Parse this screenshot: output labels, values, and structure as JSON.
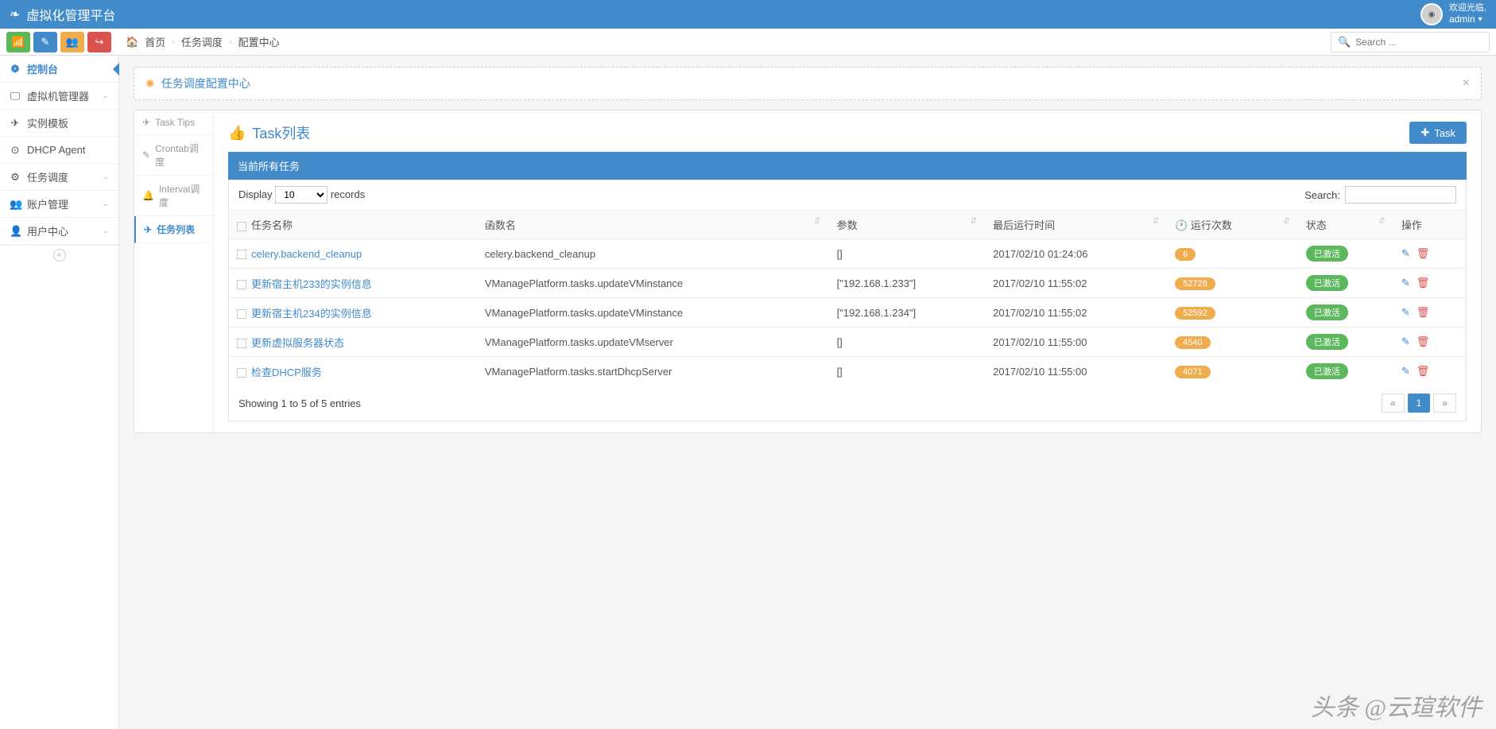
{
  "header": {
    "brand": "虚拟化管理平台",
    "greeting": "欢迎光临,",
    "username": "admin"
  },
  "breadcrumb": {
    "home": "首页",
    "items": [
      "任务调度",
      "配置中心"
    ]
  },
  "search": {
    "placeholder": "Search ..."
  },
  "sidebar": {
    "items": [
      {
        "label": "控制台",
        "active": true,
        "icon": "⚙"
      },
      {
        "label": "虚拟机管理器",
        "expandable": true,
        "icon": "🖵"
      },
      {
        "label": "实例模板",
        "icon": "✈"
      },
      {
        "label": "DHCP Agent",
        "icon": "⊙"
      },
      {
        "label": "任务调度",
        "expandable": true,
        "icon": "⚙"
      },
      {
        "label": "账户管理",
        "expandable": true,
        "icon": "👥"
      },
      {
        "label": "用户中心",
        "expandable": true,
        "icon": "👤"
      }
    ]
  },
  "alert": {
    "title": "任务调度配置中心"
  },
  "vtabs": [
    {
      "label": "Task Tips",
      "icon": "✈"
    },
    {
      "label": "Crontab调度",
      "icon": "✎"
    },
    {
      "label": "Interval调度",
      "icon": "🔔"
    },
    {
      "label": "任务列表",
      "icon": "✈",
      "active": true
    }
  ],
  "pane": {
    "title": "Task列表",
    "add_button": "Task",
    "bar": "当前所有任务"
  },
  "table": {
    "display_label": "Display",
    "display_value": "10",
    "records_label": "records",
    "search_label": "Search:",
    "columns": {
      "name": "任务名称",
      "func": "函数名",
      "params": "参数",
      "last_run": "最后运行时间",
      "run_count": "运行次数",
      "status": "状态",
      "ops": "操作"
    },
    "rows": [
      {
        "name": "celery.backend_cleanup",
        "func": "celery.backend_cleanup",
        "params": "[]",
        "last_run": "2017/02/10 01:24:06",
        "run_count": "6",
        "status": "已激活"
      },
      {
        "name": "更新宿主机233的实例信息",
        "func": "VManagePlatform.tasks.updateVMinstance",
        "params": "[\"192.168.1.233\"]",
        "last_run": "2017/02/10 11:55:02",
        "run_count": "52728",
        "status": "已激活"
      },
      {
        "name": "更新宿主机234的实例信息",
        "func": "VManagePlatform.tasks.updateVMinstance",
        "params": "[\"192.168.1.234\"]",
        "last_run": "2017/02/10 11:55:02",
        "run_count": "52592",
        "status": "已激活"
      },
      {
        "name": "更新虚拟服务器状态",
        "func": "VManagePlatform.tasks.updateVMserver",
        "params": "[]",
        "last_run": "2017/02/10 11:55:00",
        "run_count": "4540",
        "status": "已激活"
      },
      {
        "name": "检查DHCP服务",
        "func": "VManagePlatform.tasks.startDhcpServer",
        "params": "[]",
        "last_run": "2017/02/10 11:55:00",
        "run_count": "4071",
        "status": "已激活"
      }
    ],
    "footer_info": "Showing 1 to 5 of 5 entries",
    "page": "1"
  },
  "watermark": "头条 @云瑄软件"
}
